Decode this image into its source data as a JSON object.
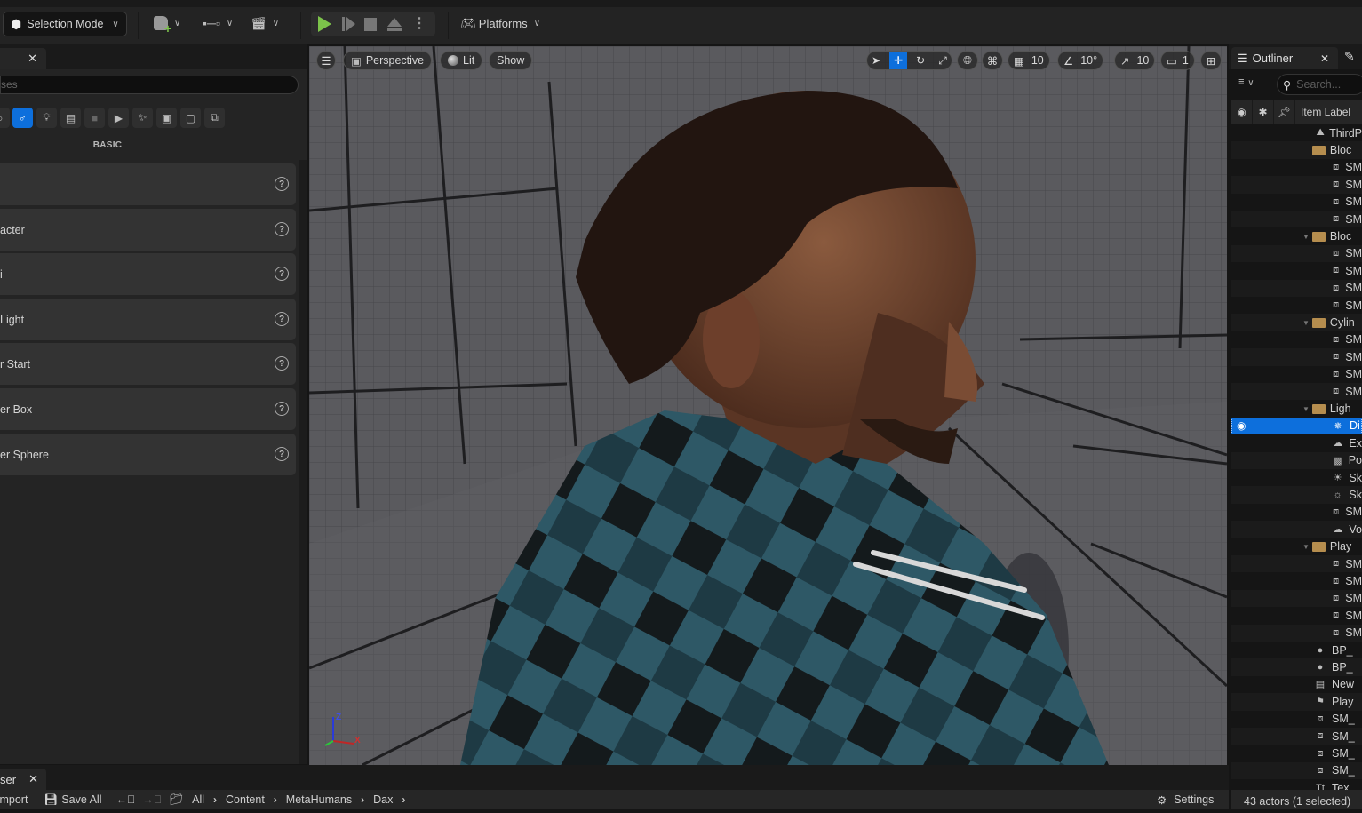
{
  "toolbar": {
    "selection_mode": "Selection Mode",
    "add_actor_icon": "add-actor-icon",
    "blueprint_icon": "blueprint-icon",
    "cinematics_icon": "cinematics-icon",
    "play_icon": "play-icon",
    "advance_frame_icon": "advance-frame-icon",
    "stop_icon": "stop-icon",
    "eject_icon": "eject-icon",
    "more_icon": "more-options-icon",
    "platforms": "Platforms",
    "play_color": "#7cc34a",
    "accent": "#0d6fdc"
  },
  "place_actors": {
    "search_placeholder": "ses",
    "category_label": "BASIC",
    "categories": [
      "recently-placed",
      "basic",
      "lights",
      "cinematic",
      "visual-effects",
      "geometry",
      "volumes",
      "all-classes",
      "shapes",
      "misc"
    ],
    "items": [
      {
        "label": ""
      },
      {
        "label": "acter"
      },
      {
        "label": "i"
      },
      {
        "label": "Light"
      },
      {
        "label": "r Start"
      },
      {
        "label": "er Box"
      },
      {
        "label": "er Sphere"
      }
    ]
  },
  "viewport": {
    "perspective": "Perspective",
    "lit": "Lit",
    "show": "Show",
    "grid_snap": "10",
    "rotation_snap": "10°",
    "scale_snap": "10",
    "camera_speed": "1",
    "axis_x": "X",
    "axis_z": "Z"
  },
  "outliner": {
    "title": "Outliner",
    "search_placeholder": "Search...",
    "column_item_label": "Item Label",
    "rows": [
      {
        "label": "ThirdP",
        "icon": "world",
        "indent": 0,
        "folder": false
      },
      {
        "label": "Bloc",
        "icon": "folder",
        "indent": 1,
        "folder": true,
        "collapsed": true
      },
      {
        "label": "SM",
        "icon": "mesh",
        "indent": 2
      },
      {
        "label": "SM",
        "icon": "mesh",
        "indent": 2
      },
      {
        "label": "SM",
        "icon": "mesh",
        "indent": 2
      },
      {
        "label": "SM",
        "icon": "mesh",
        "indent": 2
      },
      {
        "label": "Bloc",
        "icon": "folder",
        "indent": 1,
        "folder": true
      },
      {
        "label": "SM",
        "icon": "mesh",
        "indent": 2
      },
      {
        "label": "SM",
        "icon": "mesh",
        "indent": 2
      },
      {
        "label": "SM",
        "icon": "mesh",
        "indent": 2
      },
      {
        "label": "SM",
        "icon": "mesh",
        "indent": 2
      },
      {
        "label": "Cylin",
        "icon": "folder",
        "indent": 1,
        "folder": true
      },
      {
        "label": "SM",
        "icon": "mesh",
        "indent": 2
      },
      {
        "label": "SM",
        "icon": "mesh",
        "indent": 2
      },
      {
        "label": "SM",
        "icon": "mesh",
        "indent": 2
      },
      {
        "label": "SM",
        "icon": "mesh",
        "indent": 2
      },
      {
        "label": "Ligh",
        "icon": "folder",
        "indent": 1,
        "folder": true
      },
      {
        "label": "Di",
        "icon": "directional-light",
        "indent": 2,
        "selected": true
      },
      {
        "label": "Ex",
        "icon": "exponential-fog",
        "indent": 2
      },
      {
        "label": "Po",
        "icon": "post-process",
        "indent": 2
      },
      {
        "label": "Sk",
        "icon": "sky-atmosphere",
        "indent": 2
      },
      {
        "label": "Sk",
        "icon": "sky-light",
        "indent": 2
      },
      {
        "label": "SM",
        "icon": "mesh",
        "indent": 2
      },
      {
        "label": "Vo",
        "icon": "volumetric-cloud",
        "indent": 2
      },
      {
        "label": "Play",
        "icon": "folder",
        "indent": 1,
        "folder": true
      },
      {
        "label": "SM",
        "icon": "mesh",
        "indent": 2
      },
      {
        "label": "SM",
        "icon": "mesh",
        "indent": 2
      },
      {
        "label": "SM",
        "icon": "mesh",
        "indent": 2
      },
      {
        "label": "SM",
        "icon": "mesh",
        "indent": 2
      },
      {
        "label": "SM",
        "icon": "mesh",
        "indent": 2
      },
      {
        "label": "BP_",
        "icon": "blueprint-pawn",
        "indent": 1
      },
      {
        "label": "BP_",
        "icon": "blueprint-pawn",
        "indent": 1
      },
      {
        "label": "New",
        "icon": "level-sequence",
        "indent": 1
      },
      {
        "label": "Play",
        "icon": "player-start",
        "indent": 1
      },
      {
        "label": "SM_",
        "icon": "mesh",
        "indent": 1
      },
      {
        "label": "SM_",
        "icon": "mesh",
        "indent": 1
      },
      {
        "label": "SM_",
        "icon": "mesh",
        "indent": 1
      },
      {
        "label": "SM_",
        "icon": "mesh",
        "indent": 1
      },
      {
        "label": "Tex",
        "icon": "text-render",
        "indent": 1
      }
    ],
    "status": "43 actors (1 selected)"
  },
  "content_browser": {
    "tab": "ser",
    "import": "Import",
    "save_all": "Save All",
    "breadcrumb": [
      "All",
      "Content",
      "MetaHumans",
      "Dax"
    ],
    "settings": "Settings"
  }
}
